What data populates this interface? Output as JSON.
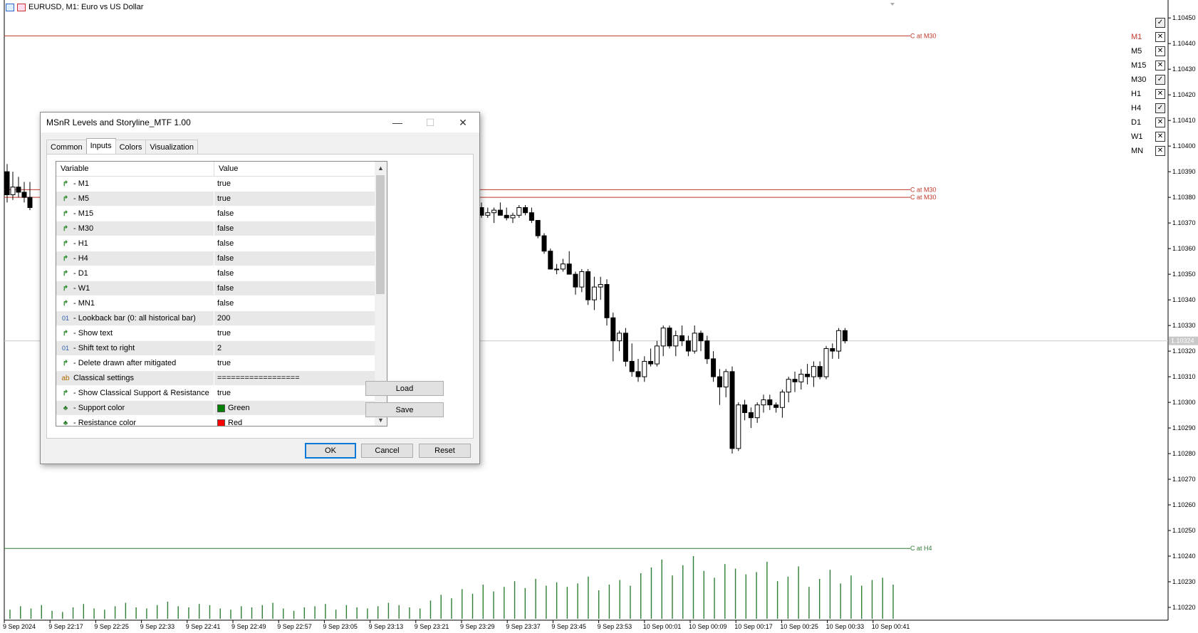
{
  "chart": {
    "title": "EURUSD, M1:  Euro vs US Dollar",
    "current_price": "1.10324",
    "price_labels": [
      "1.10450",
      "1.10440",
      "1.10430",
      "1.10420",
      "1.10410",
      "1.10400",
      "1.10390",
      "1.10380",
      "1.10370",
      "1.10360",
      "1.10350",
      "1.10340",
      "1.10330",
      "1.10320",
      "1.10310",
      "1.10300",
      "1.10290",
      "1.10280",
      "1.10270",
      "1.10260",
      "1.10250",
      "1.10240",
      "1.10230",
      "1.10220"
    ],
    "time_labels": [
      "9 Sep 2024",
      "9 Sep 22:17",
      "9 Sep 22:25",
      "9 Sep 22:33",
      "9 Sep 22:41",
      "9 Sep 22:49",
      "9 Sep 22:57",
      "9 Sep 23:05",
      "9 Sep 23:13",
      "9 Sep 23:21",
      "9 Sep 23:29",
      "9 Sep 23:37",
      "9 Sep 23:45",
      "9 Sep 23:53",
      "10 Sep 00:01",
      "10 Sep 00:09",
      "10 Sep 00:17",
      "10 Sep 00:25",
      "10 Sep 00:33",
      "10 Sep 00:41"
    ],
    "levels": [
      {
        "label": "C at M30",
        "price": 1.10443,
        "color": "#c0392b"
      },
      {
        "label": "C at M30",
        "price": 1.10383,
        "color": "#c0392b"
      },
      {
        "label": "C at M30",
        "price": 1.1038,
        "color": "#c0392b"
      },
      {
        "label": "C at H4",
        "price": 1.10243,
        "color": "#2e7d32"
      }
    ],
    "grid_line_price": 1.10324,
    "colors": {
      "up": "#ffffff",
      "down": "#000000",
      "volume": "#2e7d32"
    }
  },
  "chart_data": {
    "type": "candlestick",
    "ylim": [
      1.10215,
      1.10457
    ],
    "candles": [
      [
        1.1039,
        1.10393,
        1.10378,
        1.10381
      ],
      [
        1.10381,
        1.1039,
        1.10379,
        1.10384
      ],
      [
        1.10384,
        1.10388,
        1.1038,
        1.10382
      ],
      [
        1.10382,
        1.10386,
        1.10378,
        1.1038
      ],
      [
        1.1038,
        1.10386,
        1.10375,
        1.10376
      ],
      [
        1.10376,
        1.10378,
        1.10372,
        1.10373
      ],
      [
        1.10373,
        1.10376,
        1.10372,
        1.10374
      ],
      [
        1.10374,
        1.10376,
        1.1037,
        1.10375
      ],
      [
        1.10375,
        1.10378,
        1.10373,
        1.10373
      ],
      [
        1.10373,
        1.10376,
        1.10371,
        1.10372
      ],
      [
        1.10372,
        1.10374,
        1.1037,
        1.10373
      ],
      [
        1.10373,
        1.10377,
        1.10372,
        1.10376
      ],
      [
        1.10376,
        1.10377,
        1.10373,
        1.10374
      ],
      [
        1.10374,
        1.10376,
        1.1037,
        1.10371
      ],
      [
        1.10371,
        1.10371,
        1.10364,
        1.10365
      ],
      [
        1.10365,
        1.10366,
        1.10358,
        1.10359
      ],
      [
        1.10359,
        1.1036,
        1.10352,
        1.10352
      ],
      [
        1.10352,
        1.10354,
        1.1035,
        1.10352
      ],
      [
        1.10352,
        1.10356,
        1.10351,
        1.10354
      ],
      [
        1.10354,
        1.10359,
        1.10351,
        1.1035
      ],
      [
        1.1035,
        1.10351,
        1.10342,
        1.10345
      ],
      [
        1.10345,
        1.10352,
        1.10343,
        1.10351
      ],
      [
        1.10351,
        1.10352,
        1.10338,
        1.1034
      ],
      [
        1.1034,
        1.10349,
        1.10336,
        1.10345
      ],
      [
        1.10345,
        1.10349,
        1.1034,
        1.10346
      ],
      [
        1.10346,
        1.10348,
        1.1033,
        1.10333
      ],
      [
        1.10333,
        1.10335,
        1.10316,
        1.10324
      ],
      [
        1.10324,
        1.10328,
        1.1032,
        1.10327
      ],
      [
        1.10327,
        1.10329,
        1.10314,
        1.10316
      ],
      [
        1.10316,
        1.10323,
        1.1031,
        1.10312
      ],
      [
        1.10312,
        1.10317,
        1.10308,
        1.1031
      ],
      [
        1.1031,
        1.10318,
        1.10308,
        1.10316
      ],
      [
        1.10316,
        1.10321,
        1.10314,
        1.10315
      ],
      [
        1.10315,
        1.10324,
        1.10314,
        1.10322
      ],
      [
        1.10322,
        1.1033,
        1.10318,
        1.10329
      ],
      [
        1.10329,
        1.1033,
        1.10321,
        1.10322
      ],
      [
        1.10322,
        1.10328,
        1.10318,
        1.10326
      ],
      [
        1.10326,
        1.1033,
        1.10322,
        1.10324
      ],
      [
        1.10324,
        1.10326,
        1.10318,
        1.1032
      ],
      [
        1.1032,
        1.1033,
        1.10319,
        1.10327
      ],
      [
        1.10327,
        1.10328,
        1.1032,
        1.10324
      ],
      [
        1.10324,
        1.10326,
        1.10315,
        1.10317
      ],
      [
        1.10317,
        1.1032,
        1.10308,
        1.1031
      ],
      [
        1.1031,
        1.10313,
        1.10299,
        1.10306
      ],
      [
        1.10306,
        1.10313,
        1.10302,
        1.10312
      ],
      [
        1.10312,
        1.10314,
        1.1028,
        1.10282
      ],
      [
        1.10282,
        1.103,
        1.10281,
        1.10299
      ],
      [
        1.10299,
        1.10301,
        1.10293,
        1.10296
      ],
      [
        1.10296,
        1.10298,
        1.1029,
        1.10294
      ],
      [
        1.10294,
        1.103,
        1.10292,
        1.10299
      ],
      [
        1.10299,
        1.10303,
        1.10296,
        1.10301
      ],
      [
        1.10301,
        1.10303,
        1.10297,
        1.10299
      ],
      [
        1.10299,
        1.103,
        1.10296,
        1.10298
      ],
      [
        1.10298,
        1.10305,
        1.10294,
        1.10304
      ],
      [
        1.10304,
        1.1031,
        1.103,
        1.10309
      ],
      [
        1.10309,
        1.10312,
        1.10304,
        1.10308
      ],
      [
        1.10308,
        1.10313,
        1.10305,
        1.10311
      ],
      [
        1.10311,
        1.10315,
        1.10307,
        1.1031
      ],
      [
        1.1031,
        1.10316,
        1.10306,
        1.10314
      ],
      [
        1.10314,
        1.10316,
        1.10309,
        1.1031
      ],
      [
        1.1031,
        1.10322,
        1.10309,
        1.10321
      ],
      [
        1.10321,
        1.10323,
        1.10317,
        1.1032
      ],
      [
        1.1032,
        1.10329,
        1.10317,
        1.10328
      ],
      [
        1.10328,
        1.10329,
        1.10323,
        1.10324
      ]
    ],
    "volume": [
      8,
      11,
      9,
      12,
      7,
      6,
      10,
      13,
      9,
      8,
      11,
      14,
      10,
      9,
      12,
      15,
      11,
      10,
      13,
      12,
      9,
      8,
      11,
      10,
      12,
      14,
      9,
      7,
      10,
      11,
      13,
      8,
      12,
      10,
      9,
      11,
      14,
      12,
      10,
      9,
      16,
      21,
      18,
      26,
      22,
      30,
      24,
      28,
      33,
      27,
      35,
      29,
      32,
      28,
      31,
      37,
      25,
      30,
      34,
      29,
      40,
      45,
      52,
      38,
      47,
      55,
      42,
      36,
      48,
      44,
      39,
      41,
      50,
      33,
      37,
      46,
      28,
      35,
      43,
      31,
      38,
      29,
      34,
      36,
      30
    ]
  },
  "toolbox": {
    "items": [
      {
        "label": "",
        "state": "check"
      },
      {
        "label": "M1",
        "state": "x",
        "color": "#c0392b"
      },
      {
        "label": "M5",
        "state": "x"
      },
      {
        "label": "M15",
        "state": "x"
      },
      {
        "label": "M30",
        "state": "check"
      },
      {
        "label": "H1",
        "state": "x"
      },
      {
        "label": "H4",
        "state": "check"
      },
      {
        "label": "D1",
        "state": "x"
      },
      {
        "label": "W1",
        "state": "x"
      },
      {
        "label": "MN",
        "state": "x"
      }
    ]
  },
  "dialog": {
    "title": "MSnR Levels and Storyline_MTF 1.00",
    "tabs": [
      "Common",
      "Inputs",
      "Colors",
      "Visualization"
    ],
    "active_tab": "Inputs",
    "columns": {
      "variable": "Variable",
      "value": "Value"
    },
    "rows": [
      {
        "type": "bool",
        "name": "- M1",
        "value": "true"
      },
      {
        "type": "bool",
        "name": "- M5",
        "value": "true"
      },
      {
        "type": "bool",
        "name": "- M15",
        "value": "false"
      },
      {
        "type": "bool",
        "name": "- M30",
        "value": "false"
      },
      {
        "type": "bool",
        "name": "- H1",
        "value": "false"
      },
      {
        "type": "bool",
        "name": "- H4",
        "value": "false"
      },
      {
        "type": "bool",
        "name": "- D1",
        "value": "false"
      },
      {
        "type": "bool",
        "name": "- W1",
        "value": "false"
      },
      {
        "type": "bool",
        "name": "- MN1",
        "value": "false"
      },
      {
        "type": "num",
        "name": "- Lookback bar (0: all historical bar)",
        "value": "200"
      },
      {
        "type": "bool",
        "name": "- Show text",
        "value": "true"
      },
      {
        "type": "num",
        "name": "- Shift text to right",
        "value": "2"
      },
      {
        "type": "bool",
        "name": "- Delete drawn after mitigated",
        "value": "true"
      },
      {
        "type": "str",
        "name": "Classical settings",
        "value": "=================="
      },
      {
        "type": "bool",
        "name": "- Show Classical Support & Resistance",
        "value": "true"
      },
      {
        "type": "col",
        "name": "- Support color",
        "value": "Green",
        "swatch": "#008000"
      },
      {
        "type": "col",
        "name": "- Resistance color",
        "value": "Red",
        "swatch": "#ff0000"
      }
    ],
    "buttons": {
      "load": "Load",
      "save": "Save",
      "ok": "OK",
      "cancel": "Cancel",
      "reset": "Reset"
    },
    "icons": {
      "bool": "↱",
      "num": "01",
      "str": "ab",
      "col": "♣"
    }
  }
}
